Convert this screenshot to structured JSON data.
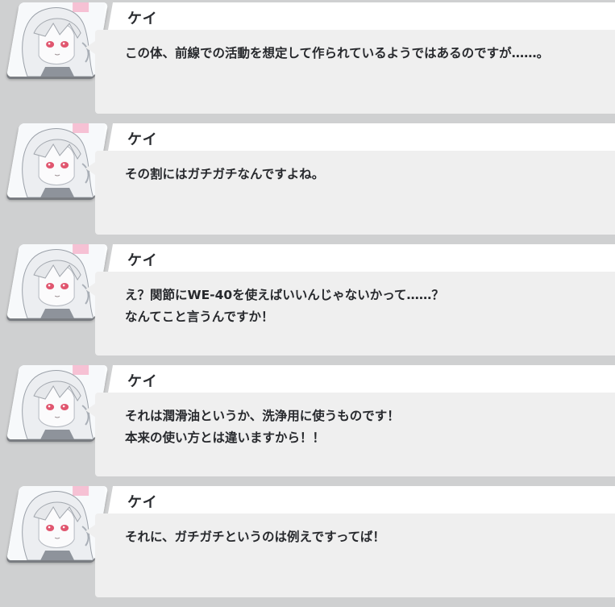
{
  "messages": [
    {
      "speaker": "ケイ",
      "lines": [
        "この体、前線での活動を想定して作られているようではあるのですが……。",
        ""
      ]
    },
    {
      "speaker": "ケイ",
      "lines": [
        "その割にはガチガチなんですよね。",
        ""
      ]
    },
    {
      "speaker": "ケイ",
      "lines": [
        "え？関節にWE-40を使えばいいんじゃないかって……？",
        "なんてこと言うんですか！"
      ]
    },
    {
      "speaker": "ケイ",
      "lines": [
        "それは潤滑油というか、洗浄用に使うものです！",
        "本来の使い方とは違いますから！！"
      ]
    },
    {
      "speaker": "ケイ",
      "lines": [
        "それに、ガチガチというのは例えですってば！",
        ""
      ]
    }
  ],
  "avatar_icon": "character-portrait-icon",
  "colors": {
    "background": "#cfd0d1",
    "bubble": "#efefef",
    "name_bar": "#ffffff",
    "eye": "#e0566f"
  }
}
